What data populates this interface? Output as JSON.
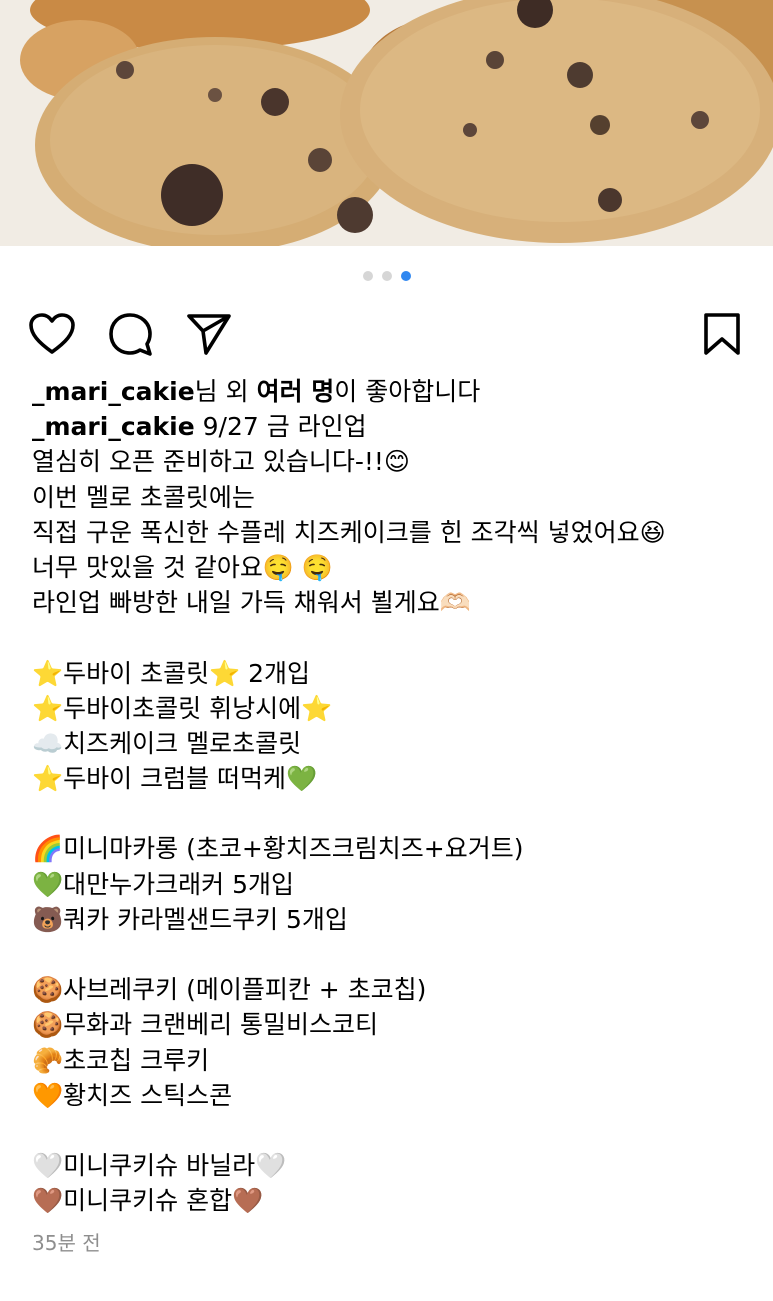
{
  "post": {
    "media": {
      "description_icon": "cookie-photo",
      "carousel": {
        "count": 3,
        "active_index": 2
      }
    },
    "actions": {
      "like_icon": "heart-icon",
      "comment_icon": "comment-icon",
      "share_icon": "send-icon",
      "save_icon": "bookmark-icon"
    },
    "likes": {
      "username": "_mari_cakie",
      "text_1": "님 외 ",
      "others": "여러 명",
      "text_2": "이 좋아합니다"
    },
    "caption": {
      "username": "_mari_cakie",
      "first_line": " 9/27 금 라인업",
      "lines": [
        "열심히 오픈 준비하고 있습니다-!!😊",
        "이번 멜로 초콜릿에는",
        "직접 구운 폭신한 수플레 치즈케이크를 힌 조각씩 넣었어요😆",
        "너무 맛있을 것 같아요🤤 🤤",
        "라인업 빠방한 내일 가득 채워서 뵐게요🫶🏻",
        "",
        "⭐두바이 초콜릿⭐ 2개입",
        "⭐두바이초콜릿 휘낭시에⭐",
        "☁️치즈케이크 멜로초콜릿",
        "⭐두바이 크럼블 떠먹케💚",
        "",
        "🌈미니마카롱 (초코+황치즈크림치즈+요거트)",
        "💚대만누가크래커 5개입",
        "🐻쿼카 카라멜샌드쿠키 5개입",
        "",
        "🍪사브레쿠키 (메이플피칸 + 초코칩)",
        "🍪무화과 크랜베리 통밀비스코티",
        "🥐초코칩 크루키",
        "🧡황치즈 스틱스콘",
        "",
        "🤍미니쿠키슈 바닐라🤍",
        "🤎미니쿠키슈 혼합🤎"
      ]
    },
    "timestamp": "35분 전"
  },
  "colors": {
    "accent": "#2f87f0",
    "dot_inactive": "#d6d6d6",
    "timestamp": "#8e8e8e"
  }
}
